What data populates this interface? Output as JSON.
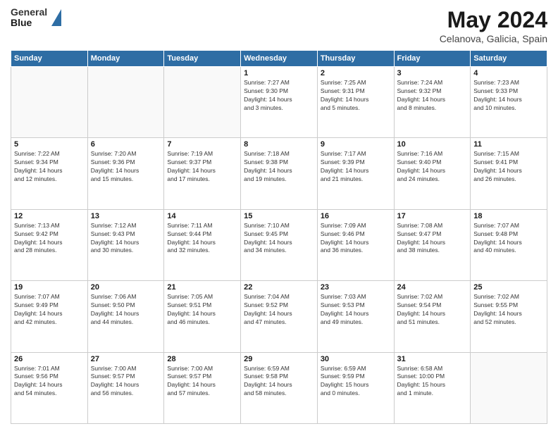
{
  "header": {
    "logo_line1": "General",
    "logo_line2": "Blue",
    "title": "May 2024",
    "subtitle": "Celanova, Galicia, Spain"
  },
  "days_of_week": [
    "Sunday",
    "Monday",
    "Tuesday",
    "Wednesday",
    "Thursday",
    "Friday",
    "Saturday"
  ],
  "weeks": [
    [
      {
        "day": "",
        "info": ""
      },
      {
        "day": "",
        "info": ""
      },
      {
        "day": "",
        "info": ""
      },
      {
        "day": "1",
        "info": "Sunrise: 7:27 AM\nSunset: 9:30 PM\nDaylight: 14 hours\nand 3 minutes."
      },
      {
        "day": "2",
        "info": "Sunrise: 7:25 AM\nSunset: 9:31 PM\nDaylight: 14 hours\nand 5 minutes."
      },
      {
        "day": "3",
        "info": "Sunrise: 7:24 AM\nSunset: 9:32 PM\nDaylight: 14 hours\nand 8 minutes."
      },
      {
        "day": "4",
        "info": "Sunrise: 7:23 AM\nSunset: 9:33 PM\nDaylight: 14 hours\nand 10 minutes."
      }
    ],
    [
      {
        "day": "5",
        "info": "Sunrise: 7:22 AM\nSunset: 9:34 PM\nDaylight: 14 hours\nand 12 minutes."
      },
      {
        "day": "6",
        "info": "Sunrise: 7:20 AM\nSunset: 9:36 PM\nDaylight: 14 hours\nand 15 minutes."
      },
      {
        "day": "7",
        "info": "Sunrise: 7:19 AM\nSunset: 9:37 PM\nDaylight: 14 hours\nand 17 minutes."
      },
      {
        "day": "8",
        "info": "Sunrise: 7:18 AM\nSunset: 9:38 PM\nDaylight: 14 hours\nand 19 minutes."
      },
      {
        "day": "9",
        "info": "Sunrise: 7:17 AM\nSunset: 9:39 PM\nDaylight: 14 hours\nand 21 minutes."
      },
      {
        "day": "10",
        "info": "Sunrise: 7:16 AM\nSunset: 9:40 PM\nDaylight: 14 hours\nand 24 minutes."
      },
      {
        "day": "11",
        "info": "Sunrise: 7:15 AM\nSunset: 9:41 PM\nDaylight: 14 hours\nand 26 minutes."
      }
    ],
    [
      {
        "day": "12",
        "info": "Sunrise: 7:13 AM\nSunset: 9:42 PM\nDaylight: 14 hours\nand 28 minutes."
      },
      {
        "day": "13",
        "info": "Sunrise: 7:12 AM\nSunset: 9:43 PM\nDaylight: 14 hours\nand 30 minutes."
      },
      {
        "day": "14",
        "info": "Sunrise: 7:11 AM\nSunset: 9:44 PM\nDaylight: 14 hours\nand 32 minutes."
      },
      {
        "day": "15",
        "info": "Sunrise: 7:10 AM\nSunset: 9:45 PM\nDaylight: 14 hours\nand 34 minutes."
      },
      {
        "day": "16",
        "info": "Sunrise: 7:09 AM\nSunset: 9:46 PM\nDaylight: 14 hours\nand 36 minutes."
      },
      {
        "day": "17",
        "info": "Sunrise: 7:08 AM\nSunset: 9:47 PM\nDaylight: 14 hours\nand 38 minutes."
      },
      {
        "day": "18",
        "info": "Sunrise: 7:07 AM\nSunset: 9:48 PM\nDaylight: 14 hours\nand 40 minutes."
      }
    ],
    [
      {
        "day": "19",
        "info": "Sunrise: 7:07 AM\nSunset: 9:49 PM\nDaylight: 14 hours\nand 42 minutes."
      },
      {
        "day": "20",
        "info": "Sunrise: 7:06 AM\nSunset: 9:50 PM\nDaylight: 14 hours\nand 44 minutes."
      },
      {
        "day": "21",
        "info": "Sunrise: 7:05 AM\nSunset: 9:51 PM\nDaylight: 14 hours\nand 46 minutes."
      },
      {
        "day": "22",
        "info": "Sunrise: 7:04 AM\nSunset: 9:52 PM\nDaylight: 14 hours\nand 47 minutes."
      },
      {
        "day": "23",
        "info": "Sunrise: 7:03 AM\nSunset: 9:53 PM\nDaylight: 14 hours\nand 49 minutes."
      },
      {
        "day": "24",
        "info": "Sunrise: 7:02 AM\nSunset: 9:54 PM\nDaylight: 14 hours\nand 51 minutes."
      },
      {
        "day": "25",
        "info": "Sunrise: 7:02 AM\nSunset: 9:55 PM\nDaylight: 14 hours\nand 52 minutes."
      }
    ],
    [
      {
        "day": "26",
        "info": "Sunrise: 7:01 AM\nSunset: 9:56 PM\nDaylight: 14 hours\nand 54 minutes."
      },
      {
        "day": "27",
        "info": "Sunrise: 7:00 AM\nSunset: 9:57 PM\nDaylight: 14 hours\nand 56 minutes."
      },
      {
        "day": "28",
        "info": "Sunrise: 7:00 AM\nSunset: 9:57 PM\nDaylight: 14 hours\nand 57 minutes."
      },
      {
        "day": "29",
        "info": "Sunrise: 6:59 AM\nSunset: 9:58 PM\nDaylight: 14 hours\nand 58 minutes."
      },
      {
        "day": "30",
        "info": "Sunrise: 6:59 AM\nSunset: 9:59 PM\nDaylight: 15 hours\nand 0 minutes."
      },
      {
        "day": "31",
        "info": "Sunrise: 6:58 AM\nSunset: 10:00 PM\nDaylight: 15 hours\nand 1 minute."
      },
      {
        "day": "",
        "info": ""
      }
    ]
  ]
}
